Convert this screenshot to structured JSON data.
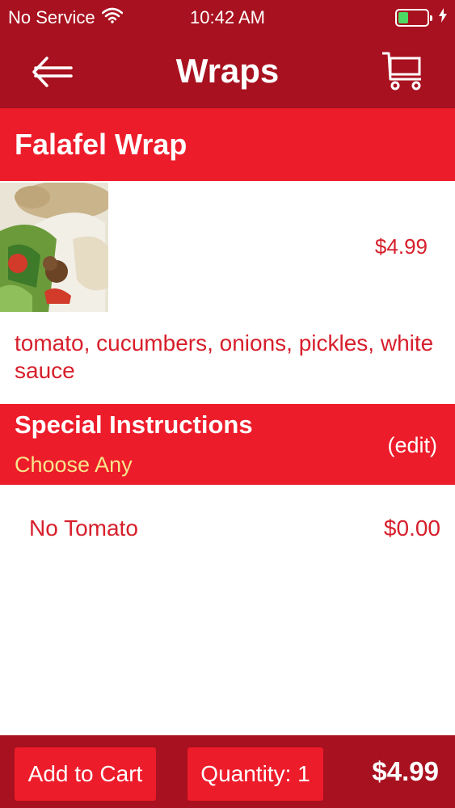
{
  "status_bar": {
    "carrier": "No Service",
    "time": "10:42 AM",
    "battery_level": 0.35,
    "battery_color": "#4cd964"
  },
  "nav": {
    "title": "Wraps",
    "back_icon": "arrow-left-icon",
    "cart_icon": "cart-icon"
  },
  "item": {
    "name": "Falafel Wrap",
    "price": "$4.99",
    "description": "tomato, cucumbers, onions, pickles, white sauce"
  },
  "special_instructions": {
    "title": "Special Instructions",
    "subtitle": "Choose Any",
    "edit_label": "(edit)",
    "options": [
      {
        "name": "No Tomato",
        "price": "$0.00"
      }
    ]
  },
  "footer": {
    "add_to_cart_label": "Add to Cart",
    "quantity_label": "Quantity: 1",
    "total": "$4.99"
  },
  "colors": {
    "header_red": "#a8111f",
    "accent_red": "#ed1c2a",
    "text_red": "#d71f2b",
    "subtitle_yellow": "#f7e48c"
  }
}
